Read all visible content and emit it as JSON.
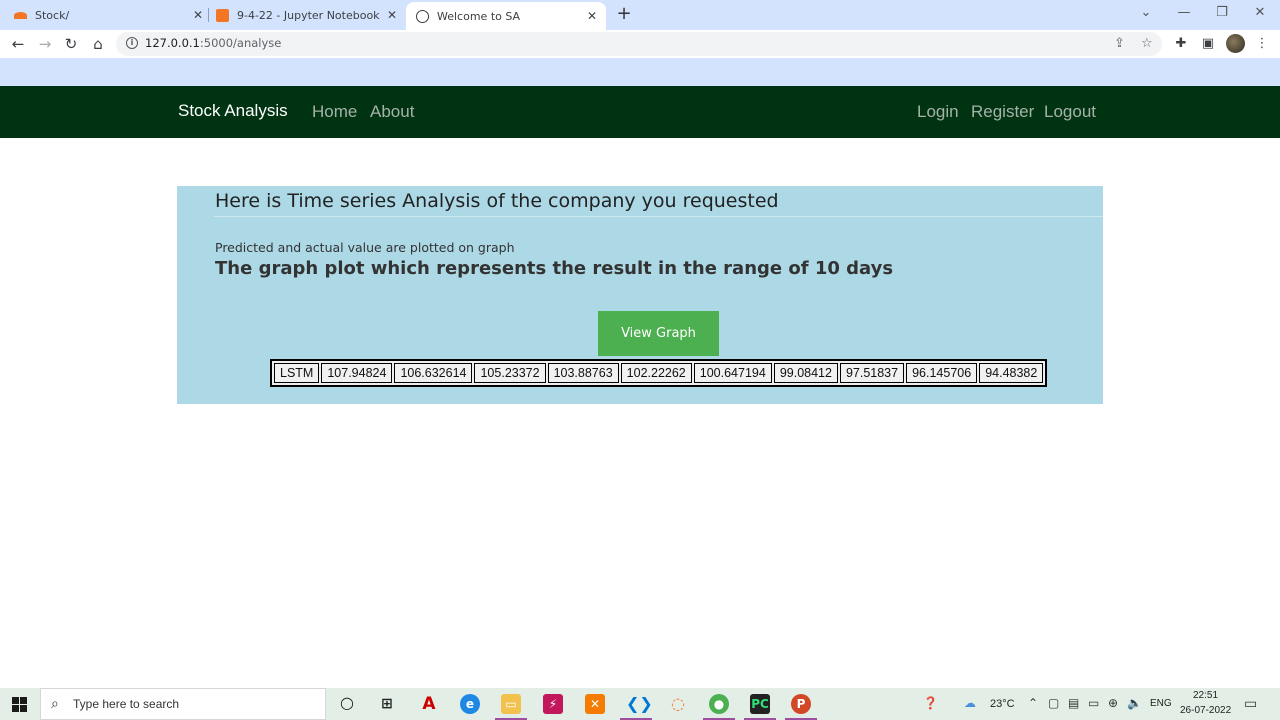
{
  "browser": {
    "tabs": [
      {
        "title": "Stock/",
        "favicon_color": "#f37626"
      },
      {
        "title": "9-4-22 - Jupyter Notebook",
        "favicon_color": "#f37626"
      },
      {
        "title": "Welcome to SA",
        "favicon_color": "#3c4043"
      }
    ],
    "url_host": "127.0.0.1",
    "url_rest": ":5000/analyse"
  },
  "site": {
    "brand": "Stock Analysis",
    "nav_left": [
      "Home",
      "About"
    ],
    "nav_right": [
      "Login",
      "Register",
      "Logout"
    ],
    "nav_color": "#003311"
  },
  "panel": {
    "title": "Here is Time series Analysis of the company you requested",
    "subtitle": "Predicted and actual value are plotted on graph",
    "heading": "The graph plot which represents the result in the range of 10 days",
    "button_label": "View Graph",
    "background": "#add8e6",
    "button_color": "#4caf50"
  },
  "results": {
    "model": "LSTM",
    "values": [
      "107.94824",
      "106.632614",
      "105.23372",
      "103.88763",
      "102.22262",
      "100.647194",
      "99.08412",
      "97.51837",
      "96.145706",
      "94.48382"
    ]
  },
  "taskbar": {
    "search_placeholder": "Type here to search",
    "temperature": "23°C",
    "language": "ENG",
    "time": "22:51",
    "date": "26-07-2022"
  }
}
